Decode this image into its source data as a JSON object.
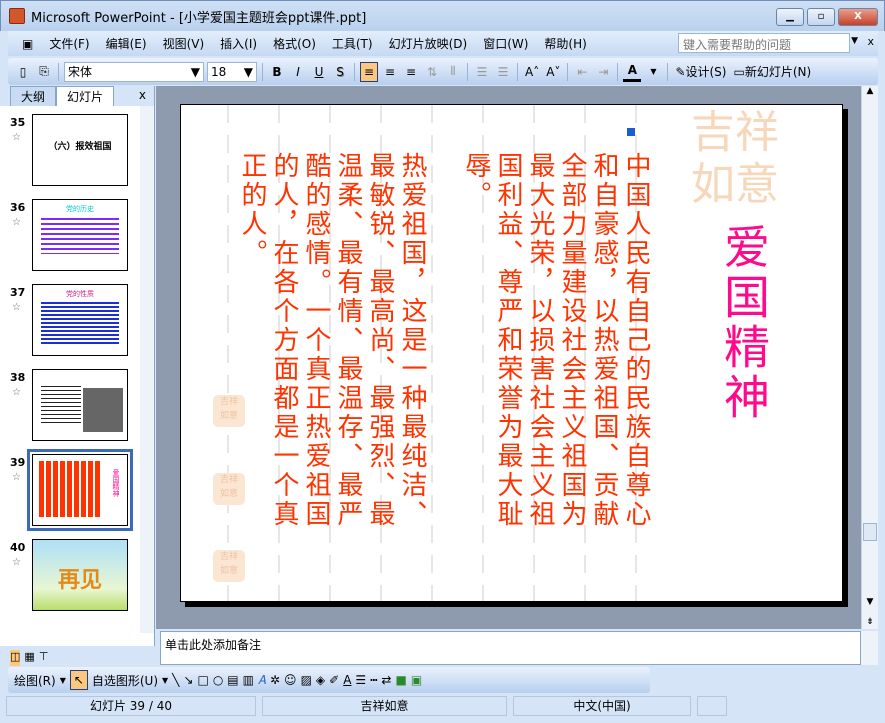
{
  "window": {
    "title": "Microsoft PowerPoint - [小学爱国主题班会ppt课件.ppt]",
    "minimize": "▁",
    "restore": "▫",
    "close": "X"
  },
  "menu": [
    "文件(F)",
    "编辑(E)",
    "视图(V)",
    "插入(I)",
    "格式(O)",
    "工具(T)",
    "幻灯片放映(D)",
    "窗口(W)",
    "帮助(H)"
  ],
  "help": {
    "placeholder": "键入需要帮助的问题",
    "close": "x"
  },
  "toolbar": {
    "font": "宋体",
    "size": "18",
    "bold": "B",
    "italic": "I",
    "underline": "U",
    "shadow": "S",
    "design": "设计(S)",
    "new_slide": "新幻灯片(N)",
    "font_color": "A"
  },
  "pane": {
    "tabs": [
      "大纲",
      "幻灯片"
    ],
    "close": "x"
  },
  "thumbnails": [
    {
      "num": "35",
      "title": "（六）报效祖国"
    },
    {
      "num": "36",
      "title": "党的历史"
    },
    {
      "num": "37",
      "title": "党的性质"
    },
    {
      "num": "38",
      "title": ""
    },
    {
      "num": "39",
      "title": "爱国精神",
      "selected": true
    },
    {
      "num": "40",
      "title": "再见"
    }
  ],
  "slide": {
    "title": "爱国精神",
    "logo": "吉祥如意",
    "paragraph1": [
      "中国人民有自己的民族自尊心",
      "和自豪感，以热爱祖国、贡献",
      "全部力量建设社会主义祖国为",
      "最大光荣，以损害社会主义祖",
      "国利益、尊严和荣誉为最大耻",
      "辱。"
    ],
    "paragraph2": [
      "热爱祖国，这是一种最纯洁、",
      "最敏锐、最高尚、最强烈、最",
      "温柔、最有情、最温存、最严",
      "酷的感情。一个真正热爱祖国",
      "的人，在各个方面都是一个真",
      "正的人。"
    ],
    "text_color": "#ff3300",
    "title_color": "#ff0a8c"
  },
  "notes": {
    "placeholder": "单击此处添加备注"
  },
  "drawbar": {
    "draw": "绘图(R)",
    "autoshapes": "自选图形(U)"
  },
  "status": {
    "slide": "幻灯片 39 / 40",
    "design": "吉祥如意",
    "lang": "中文(中国)"
  }
}
